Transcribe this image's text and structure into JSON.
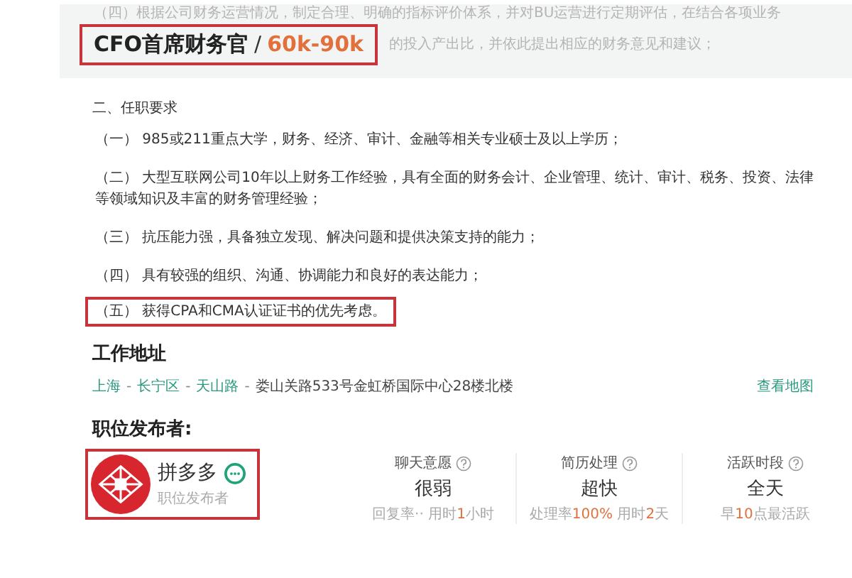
{
  "faded_text": [
    "（四）根据公司财务运营情况，制定合理、明确的指标评价体系，并对BU运营进行定期评估，在结合各项业务",
    "的投入产出比，并依此提出相应的财务意见和建议；"
  ],
  "title": {
    "name": "CFO首席财务官",
    "separator": "/",
    "salary": "60k-90k",
    "highlighted": true
  },
  "requirements": {
    "heading": "二、任职要求",
    "items": [
      {
        "text": "（一） 985或211重点大学，财务、经济、审计、金融等相关专业硕士及以上学历；",
        "highlighted": false
      },
      {
        "text": "（二） 大型互联网公司10年以上财务工作经验，具有全面的财务会计、企业管理、统计、审计、税务、投资、法律等领域知识及丰富的财务管理经验；",
        "highlighted": false
      },
      {
        "text": "（三） 抗压能力强，具备独立发现、解决问题和提供决策支持的能力；",
        "highlighted": false
      },
      {
        "text": "（四） 具有较强的组织、沟通、协调能力和良好的表达能力；",
        "highlighted": false
      },
      {
        "text": "（五） 获得CPA和CMA认证证书的优先考虑。",
        "highlighted": true
      }
    ]
  },
  "address": {
    "heading": "工作地址",
    "links": [
      "上海",
      "长宁区",
      "天山路"
    ],
    "separator": "-",
    "detail": "娄山关路533号金虹桥国际中心28楼北楼",
    "map_link": "查看地图"
  },
  "publisher": {
    "heading": "职位发布者:",
    "name": "拼多多",
    "role": "职位发布者",
    "highlighted": true
  },
  "stats": [
    {
      "label": "聊天意愿",
      "value": "很弱",
      "detail": "回复率··  用时**1**小时"
    },
    {
      "label": "简历处理",
      "value": "超快",
      "detail": "处理率**100%**  用时**2**天"
    },
    {
      "label": "活跃时段",
      "value": "全天",
      "detail": "早**10**点最活跃"
    }
  ]
}
